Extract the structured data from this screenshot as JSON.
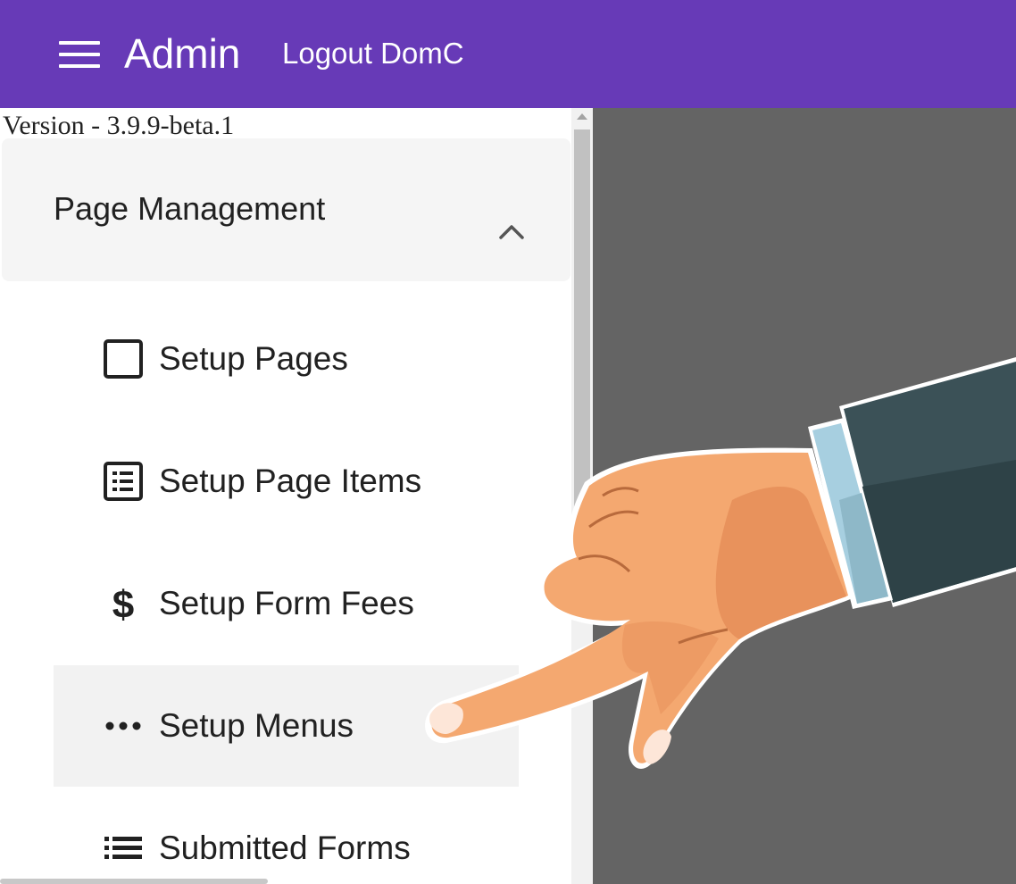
{
  "header": {
    "menu_icon": "hamburger-menu-icon",
    "title": "Admin",
    "logout_label": "Logout DomC",
    "background_color": "#673ab7"
  },
  "sidebar": {
    "version": "Version - 3.9.9-beta.1",
    "panel": {
      "title": "Page Management",
      "expanded": true,
      "toggle_icon": "chevron-up-icon"
    },
    "items": [
      {
        "label": "Setup Pages",
        "icon": "square-outline-icon",
        "active": false
      },
      {
        "label": "Setup Page Items",
        "icon": "list-box-icon",
        "active": false
      },
      {
        "label": "Setup Form Fees",
        "icon": "dollar-icon",
        "active": false
      },
      {
        "label": "Setup Menus",
        "icon": "more-horizontal-icon",
        "active": true
      },
      {
        "label": "Submitted Forms",
        "icon": "list-icon",
        "active": false
      }
    ]
  },
  "overlay": {
    "illustration": "pointing-hand-icon"
  },
  "colors": {
    "content_background": "#646464",
    "active_item_background": "#f2f2f2"
  }
}
